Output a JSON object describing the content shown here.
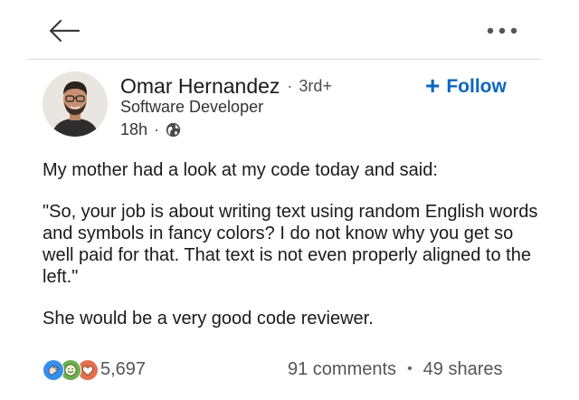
{
  "topbar": {
    "back_icon": "arrow-left-icon",
    "more_icon": "more-horizontal-icon"
  },
  "author": {
    "name": "Omar Hernandez",
    "separator": "·",
    "degree": "3rd+",
    "headline": "Software Developer",
    "time": "18h",
    "meta_separator": "·",
    "visibility_icon": "globe-icon",
    "avatar_icon": "profile-photo"
  },
  "follow": {
    "plus": "+",
    "label": "Follow",
    "color": "#0a66c2"
  },
  "post": {
    "paragraphs": [
      "My mother had a look at my code today and said:",
      "\"So, your job is about writing text using random English words and symbols in fancy colors? I do not know why you get so well paid for that. That text is not even properly aligned to the left.\"",
      "She would be a very good code reviewer."
    ]
  },
  "footer": {
    "reaction_icons": [
      "clap-icon",
      "support-icon",
      "love-icon"
    ],
    "reaction_colors": {
      "clap": "#378fe9",
      "support": "#6dae4f",
      "love": "#df704d"
    },
    "reaction_count": "5,697",
    "comments": "91 comments",
    "separator": "•",
    "shares": "49 shares"
  }
}
